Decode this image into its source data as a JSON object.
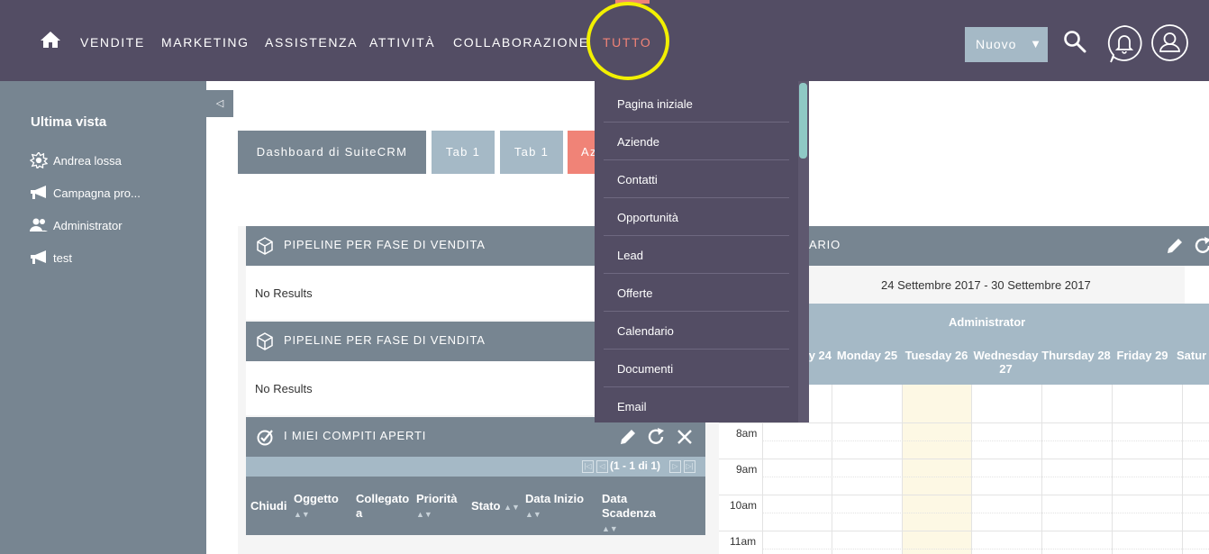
{
  "nav": {
    "items": [
      "VENDITE",
      "MARKETING",
      "ASSISTENZA",
      "ATTIVITÀ",
      "COLLABORAZIONE",
      "TUTTO"
    ],
    "new_button": "Nuovo",
    "active_color": "#f08377"
  },
  "sidebar": {
    "title": "Ultima vista",
    "items": [
      {
        "label": "Andrea lossa",
        "icon": "gear-icon"
      },
      {
        "label": "Campagna pro...",
        "icon": "megaphone-icon"
      },
      {
        "label": "Administrator",
        "icon": "users-icon"
      },
      {
        "label": "test",
        "icon": "megaphone-icon"
      }
    ]
  },
  "tabs": [
    "Dashboard di SuiteCRM",
    "Tab 1",
    "Tab 1",
    "Az"
  ],
  "dropdown": {
    "items": [
      "Pagina iniziale",
      "Aziende",
      "Contatti",
      "Opportunità",
      "Lead",
      "Offerte",
      "Calendario",
      "Documenti",
      "Email"
    ]
  },
  "dashlets": {
    "pipeline1": {
      "title": "PIPELINE PER FASE DI VENDITA",
      "body": "No Results"
    },
    "pipeline2": {
      "title": "PIPELINE PER FASE DI VENDITA",
      "body": "No Results"
    },
    "tasks": {
      "title": "I MIEI COMPITI APERTI",
      "pager": "(1 - 1 di 1)",
      "columns": [
        "Chiudi",
        "Oggetto",
        "Collegato a",
        "Priorità",
        "Stato",
        "Data Inizio",
        "Data Scadenza"
      ]
    }
  },
  "calendar": {
    "title_visible": "ARIO",
    "range": "24 Settembre 2017 - 30 Settembre 2017",
    "user": "Administrator",
    "days": [
      "y 24",
      "Monday 25",
      "Tuesday 26",
      "Wednesday 27",
      "Thursday 28",
      "Friday 29",
      "Satur"
    ],
    "hours": [
      "8am",
      "9am",
      "10am",
      "11am"
    ]
  },
  "colors": {
    "topbar": "#534d64",
    "sidebar": "#778591",
    "accent": "#f08377",
    "highlight": "#f2f000"
  }
}
